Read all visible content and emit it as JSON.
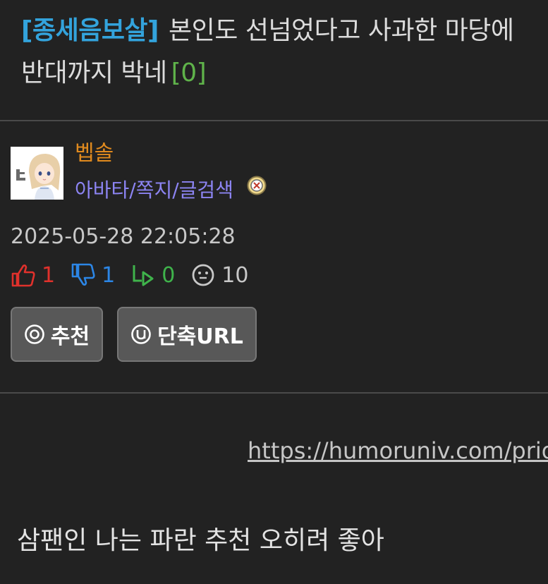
{
  "post": {
    "category": "[종세음보살]",
    "title": "본인도 선넘었다고 사과한 마당에 반대까지 박네",
    "comment_count": "[0]"
  },
  "author": {
    "nickname": "벱솔",
    "member_links": "아바타/쪽지/글검색"
  },
  "meta": {
    "date": "2025-05-28 22:05:28"
  },
  "stats": {
    "upvotes": "1",
    "downvotes": "1",
    "replies": "0",
    "views": "10"
  },
  "buttons": {
    "recommend_label": "추천",
    "shorturl_label": "단축URL"
  },
  "content": {
    "link": "https://humoruniv.com/pride",
    "text": "삼팬인 나는 파란 추천 오히려 좋아"
  },
  "colors": {
    "category": "#33a3dc",
    "comment_count": "#5fb34a",
    "nickname": "#e08a1e",
    "member_links": "#8c84f2",
    "upvote": "#e0312c",
    "downvote": "#2c86e6",
    "reply": "#3fb34b"
  },
  "icons": {
    "upvote": "thumb-up-icon",
    "downvote": "thumb-down-icon",
    "reply": "reply-arrow-icon",
    "view": "smiley-icon",
    "level": "level-badge-icon",
    "recommend": "circled-o-icon",
    "shorturl": "circled-u-icon"
  }
}
